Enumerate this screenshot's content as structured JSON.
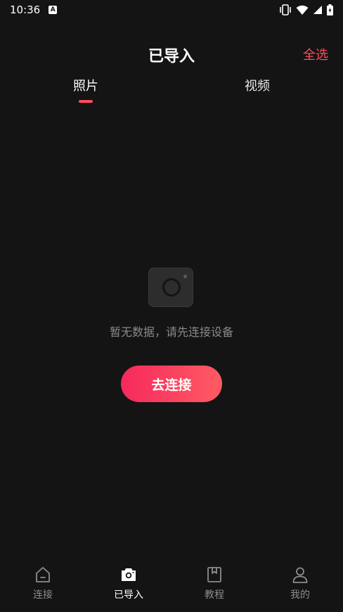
{
  "status_bar": {
    "time": "10:36",
    "notification_badge": "A",
    "icons": [
      "vibrate-icon",
      "wifi-icon",
      "signal-icon",
      "battery-icon"
    ]
  },
  "header": {
    "title": "已导入",
    "select_all": "全选"
  },
  "tabs": [
    {
      "label": "照片",
      "active": true
    },
    {
      "label": "视频",
      "active": false
    }
  ],
  "empty_state": {
    "icon": "camera-icon",
    "message": "暂无数据，请先连接设备",
    "button_label": "去连接"
  },
  "bottom_nav": [
    {
      "label": "连接",
      "icon": "home-icon",
      "active": false
    },
    {
      "label": "已导入",
      "icon": "camera-icon",
      "active": true
    },
    {
      "label": "教程",
      "icon": "bookmark-icon",
      "active": false
    },
    {
      "label": "我的",
      "icon": "user-icon",
      "active": false
    }
  ],
  "colors": {
    "background": "#141414",
    "accent": "#ff4d5e",
    "button_gradient_start": "#f6295d",
    "button_gradient_end": "#ff5b63",
    "inactive_text": "#8c8c8c"
  }
}
